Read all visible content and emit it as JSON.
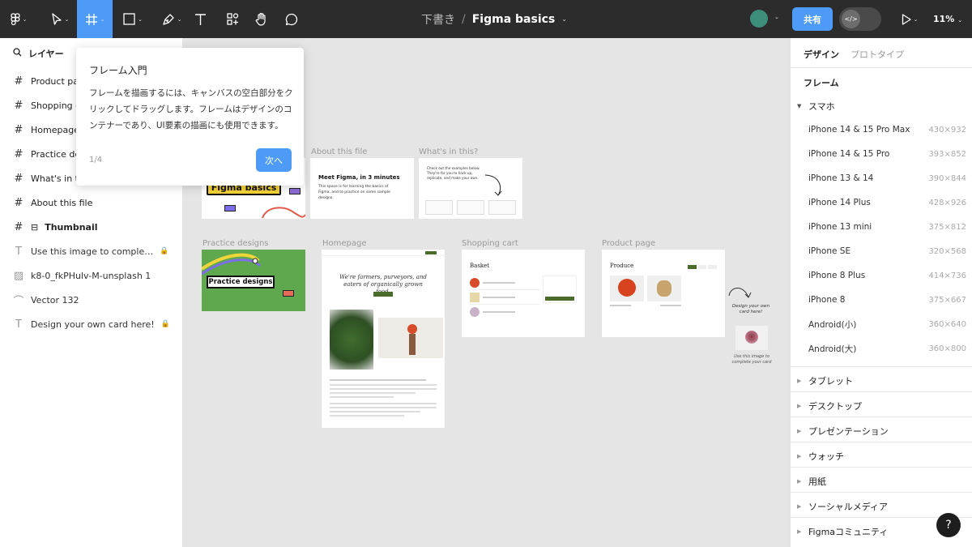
{
  "toolbar": {
    "tools": [
      {
        "name": "main-menu",
        "icon": "figma-logo-icon"
      },
      {
        "name": "move-tool",
        "icon": "cursor-icon"
      },
      {
        "name": "frame-tool",
        "icon": "frame-hash-icon",
        "active": true
      },
      {
        "name": "shape-tool",
        "icon": "rectangle-icon"
      },
      {
        "name": "pen-tool",
        "icon": "pen-icon"
      },
      {
        "name": "text-tool",
        "icon": "text-icon"
      },
      {
        "name": "resources-tool",
        "icon": "resources-icon"
      },
      {
        "name": "hand-tool",
        "icon": "hand-icon"
      },
      {
        "name": "comment-tool",
        "icon": "comment-icon"
      }
    ],
    "draft_label": "下書き",
    "separator": "/",
    "file_name": "Figma basics",
    "share_label": "共有",
    "dev_mode_icon": "code-icon",
    "zoom": "11%"
  },
  "layers": {
    "header": "レイヤー",
    "items": [
      {
        "icon": "#",
        "label": "Product page",
        "kind": "frame"
      },
      {
        "icon": "#",
        "label": "Shopping cart",
        "kind": "frame"
      },
      {
        "icon": "#",
        "label": "Homepage",
        "kind": "frame"
      },
      {
        "icon": "#",
        "label": "Practice designs",
        "kind": "frame"
      },
      {
        "icon": "#",
        "label": "What's in this?",
        "kind": "frame"
      },
      {
        "icon": "#",
        "label": "About this file",
        "kind": "frame"
      },
      {
        "icon": "#",
        "label": "Thumbnail",
        "kind": "frame-component"
      },
      {
        "icon": "T",
        "label": "Use this image to comple…",
        "kind": "text",
        "locked": true
      },
      {
        "icon": "▨",
        "label": "k8-0_fkPHulv-M-unsplash 1",
        "kind": "image"
      },
      {
        "icon": "⌒",
        "label": "Vector 132",
        "kind": "vector"
      },
      {
        "icon": "T",
        "label": "Design your own card here!",
        "kind": "text",
        "locked": true
      }
    ]
  },
  "popover": {
    "title": "フレーム入門",
    "body": "フレームを描画するには、キャンバスの空白部分をクリックしてドラッグします。フレームはデザインのコンテナーであり、UI要素の描画にも使用できます。",
    "step": "1/4",
    "next_label": "次へ"
  },
  "canvas": {
    "frame_labels": {
      "about": "About this file",
      "whats_in": "What's in this?",
      "practice": "Practice designs",
      "homepage": "Homepage",
      "cart": "Shopping cart",
      "product": "Product page"
    },
    "thumbnail_text": "Figma basics",
    "about_title": "Meet Figma, in 3 minutes",
    "about_body": "This space is for learning the basics of Figma, and to practice on some sample designs.",
    "whats_in_body": "Check out the examples below. They're for you to hack up, replicate, and make your own.",
    "practice_text": "Practice designs",
    "homepage_headline": "We're farmers, purveyors, and eaters of organically grown food.",
    "cart_title": "Basket",
    "product_title": "Produce",
    "card_note": "Design your own card here!",
    "image_note": "Use this image to complete your card"
  },
  "right_panel": {
    "tabs": [
      "デザイン",
      "プロトタイプ"
    ],
    "section": "フレーム",
    "open_group": "スマホ",
    "devices": [
      {
        "name": "iPhone 14 & 15 Pro Max",
        "size": "430×932"
      },
      {
        "name": "iPhone 14 & 15 Pro",
        "size": "393×852"
      },
      {
        "name": "iPhone 13 & 14",
        "size": "390×844"
      },
      {
        "name": "iPhone 14 Plus",
        "size": "428×926"
      },
      {
        "name": "iPhone 13 mini",
        "size": "375×812"
      },
      {
        "name": "iPhone SE",
        "size": "320×568"
      },
      {
        "name": "iPhone 8 Plus",
        "size": "414×736"
      },
      {
        "name": "iPhone 8",
        "size": "375×667"
      },
      {
        "name": "Android(小)",
        "size": "360×640"
      },
      {
        "name": "Android(大)",
        "size": "360×800"
      }
    ],
    "groups": [
      "タブレット",
      "デスクトップ",
      "プレゼンテーション",
      "ウォッチ",
      "用紙",
      "ソーシャルメディア",
      "Figmaコミュニティ"
    ]
  },
  "help_label": "?",
  "colors": {
    "accent": "#4d9bf6",
    "toolbar_bg": "#2c2c2c",
    "canvas_bg": "#e5e5e5",
    "avatar": "#3d8f7c",
    "practice_green": "#5fa84d",
    "thumbnail_yellow": "#f5d235",
    "brand_green": "#4a6b2a"
  }
}
